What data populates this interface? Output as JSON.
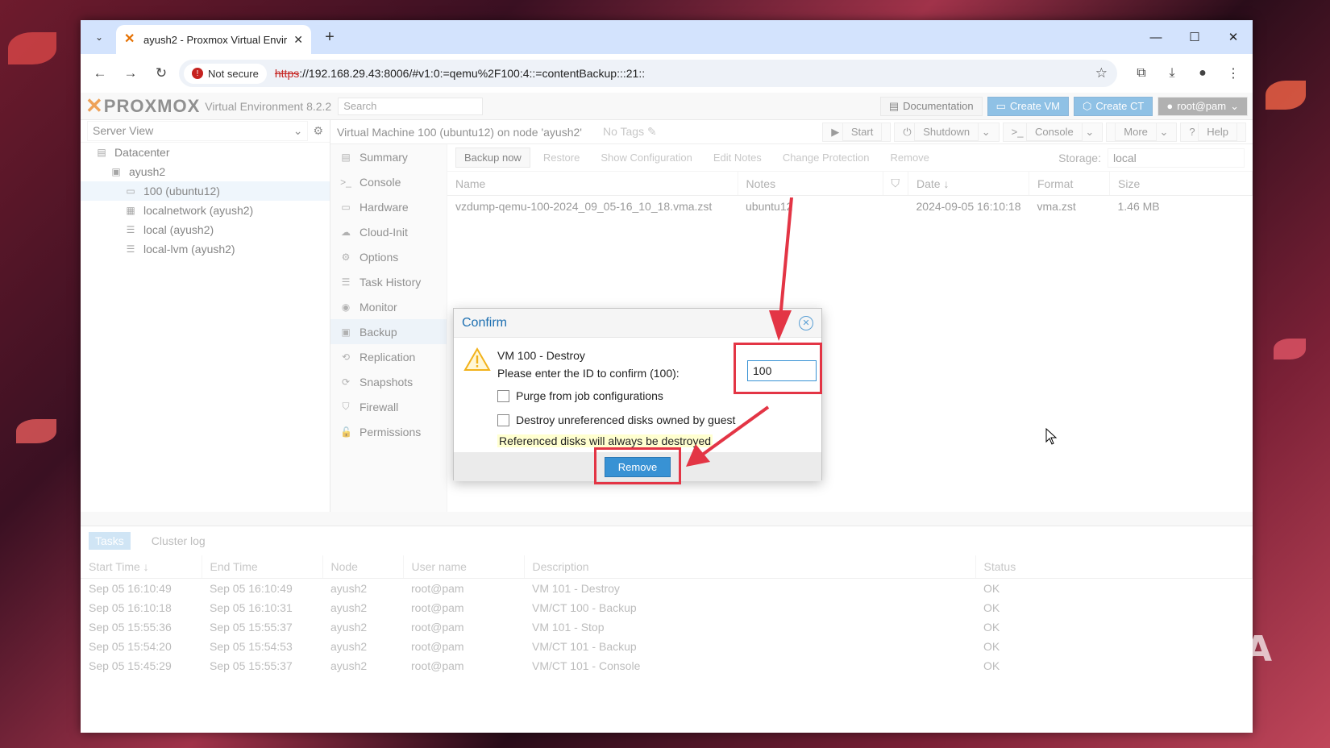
{
  "browser": {
    "tab_title": "ayush2 - Proxmox Virtual Envirç",
    "not_secure": "Not secure",
    "url_scheme": "https",
    "url_rest": "://192.168.29.43:8006/#v1:0:=qemu%2F100:4::=contentBackup:::21::"
  },
  "pve": {
    "logo": "PROXMOX",
    "version": "Virtual Environment 8.2.2",
    "search_placeholder": "Search",
    "header_buttons": {
      "documentation": "Documentation",
      "create_vm": "Create VM",
      "create_ct": "Create CT",
      "user": "root@pam"
    },
    "server_view": "Server View",
    "tree": [
      {
        "label": "Datacenter",
        "icon": "datacenter-icon",
        "indent": 0
      },
      {
        "label": "ayush2",
        "icon": "node-icon",
        "indent": 1
      },
      {
        "label": "100 (ubuntu12)",
        "icon": "vm-icon",
        "indent": 2
      },
      {
        "label": "localnetwork (ayush2)",
        "icon": "network-icon",
        "indent": 2
      },
      {
        "label": "local (ayush2)",
        "icon": "storage-icon",
        "indent": 2
      },
      {
        "label": "local-lvm (ayush2)",
        "icon": "storage-icon",
        "indent": 2
      }
    ],
    "vm_title": "Virtual Machine 100 (ubuntu12) on node 'ayush2'",
    "no_tags": "No Tags",
    "vm_actions": {
      "start": "Start",
      "shutdown": "Shutdown",
      "console": "Console",
      "more": "More",
      "help": "Help"
    },
    "menu": [
      "Summary",
      "Console",
      "Hardware",
      "Cloud-Init",
      "Options",
      "Task History",
      "Monitor",
      "Backup",
      "Replication",
      "Snapshots",
      "Firewall",
      "Permissions"
    ],
    "backup_toolbar": {
      "backup_now": "Backup now",
      "restore": "Restore",
      "show_config": "Show Configuration",
      "edit_notes": "Edit Notes",
      "change_protection": "Change Protection",
      "remove": "Remove",
      "storage_label": "Storage:",
      "storage_value": "local"
    },
    "backup_columns": {
      "name": "Name",
      "notes": "Notes",
      "date": "Date",
      "format": "Format",
      "size": "Size"
    },
    "backup_rows": [
      {
        "name": "vzdump-qemu-100-2024_09_05-16_10_18.vma.zst",
        "notes": "ubuntu12",
        "date": "2024-09-05 16:10:18",
        "format": "vma.zst",
        "size": "1.46 MB"
      }
    ],
    "tasks_tabs": {
      "tasks": "Tasks",
      "cluster_log": "Cluster log"
    },
    "tasks_columns": {
      "start": "Start Time",
      "end": "End Time",
      "node": "Node",
      "user": "User name",
      "desc": "Description",
      "status": "Status"
    },
    "tasks_rows": [
      {
        "start": "Sep 05 16:10:49",
        "end": "Sep 05 16:10:49",
        "node": "ayush2",
        "user": "root@pam",
        "desc": "VM 101 - Destroy",
        "status": "OK"
      },
      {
        "start": "Sep 05 16:10:18",
        "end": "Sep 05 16:10:31",
        "node": "ayush2",
        "user": "root@pam",
        "desc": "VM/CT 100 - Backup",
        "status": "OK"
      },
      {
        "start": "Sep 05 15:55:36",
        "end": "Sep 05 15:55:37",
        "node": "ayush2",
        "user": "root@pam",
        "desc": "VM 101 - Stop",
        "status": "OK"
      },
      {
        "start": "Sep 05 15:54:20",
        "end": "Sep 05 15:54:53",
        "node": "ayush2",
        "user": "root@pam",
        "desc": "VM/CT 101 - Backup",
        "status": "OK"
      },
      {
        "start": "Sep 05 15:45:29",
        "end": "Sep 05 15:55:37",
        "node": "ayush2",
        "user": "root@pam",
        "desc": "VM/CT 101 - Console",
        "status": "OK"
      }
    ]
  },
  "dialog": {
    "title": "Confirm",
    "line1": "VM 100 - Destroy",
    "line2": "Please enter the ID to confirm (100):",
    "input_value": "100",
    "purge_label": "Purge from job configurations",
    "destroy_label": "Destroy unreferenced disks owned by guest",
    "note": "Referenced disks will always be destroyed",
    "remove_button": "Remove"
  },
  "watermark": "XDA",
  "colors": {
    "accent": "#3892d4",
    "highlight": "#e33545",
    "brand_orange": "#e57000"
  }
}
